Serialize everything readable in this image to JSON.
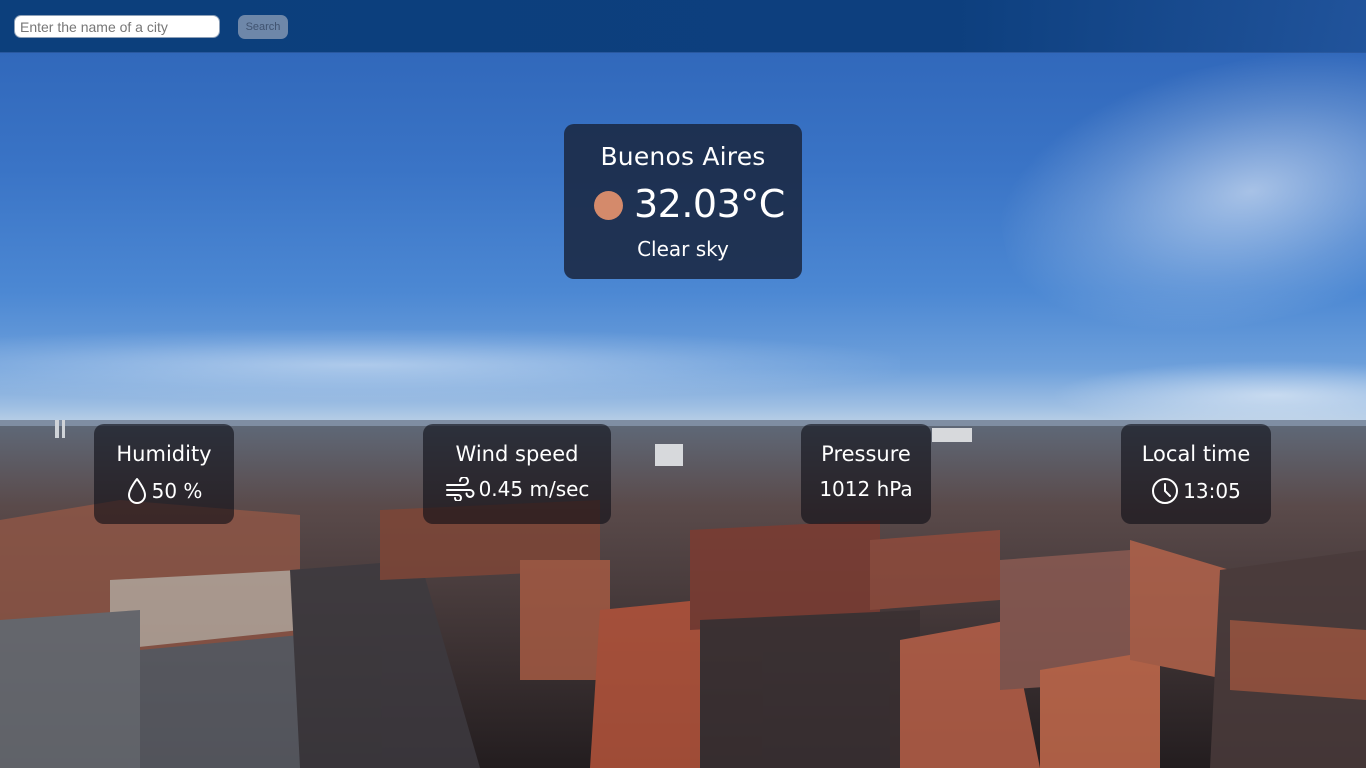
{
  "search": {
    "placeholder": "Enter the name of a city",
    "button_label": "Search"
  },
  "weather": {
    "city": "Buenos Aires",
    "temperature": "32.03°C",
    "condition": "Clear sky",
    "icon": "sun-dot-icon",
    "icon_color": "#d48a6b"
  },
  "details": {
    "humidity": {
      "title": "Humidity",
      "value": "50 %",
      "icon": "droplet-icon"
    },
    "wind": {
      "title": "Wind speed",
      "value": "0.45 m/sec",
      "icon": "wind-icon"
    },
    "pressure": {
      "title": "Pressure",
      "value": "1012 hPa"
    },
    "local_time": {
      "title": "Local time",
      "value": "13:05",
      "icon": "clock-icon"
    }
  },
  "colors": {
    "header_bg": "#0c3f7c",
    "card_bg": "#1a2842",
    "button_bg": "#6e87a9"
  }
}
